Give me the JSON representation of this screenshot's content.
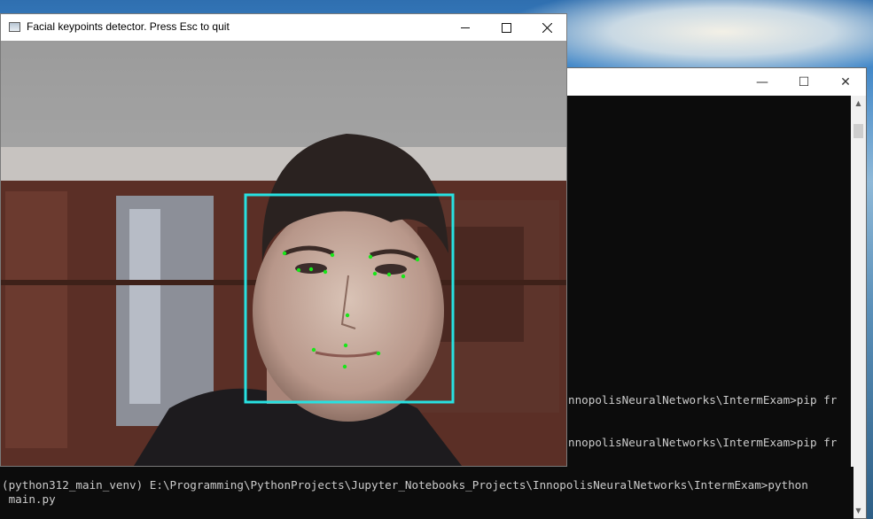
{
  "camera_window": {
    "title": "Facial keypoints detector. Press Esc to quit",
    "controls": {
      "minimize": "—",
      "maximize": "☐",
      "close": "✕"
    },
    "detection_box_color": "#27e1e1",
    "keypoint_color": "#19e619"
  },
  "terminal_window": {
    "controls": {
      "minimize": "—",
      "maximize": "☐",
      "close": "✕"
    },
    "lines": [
      "nnopolisNeuralNetworks\\IntermExam>pip fr",
      "nnopolisNeuralNetworks\\IntermExam>pip fr"
    ]
  },
  "console": {
    "prompt_line": "(python312_main_venv) E:\\Programming\\PythonProjects\\Jupyter_Notebooks_Projects\\InnopolisNeuralNetworks\\IntermExam>python",
    "continuation": " main.py"
  }
}
